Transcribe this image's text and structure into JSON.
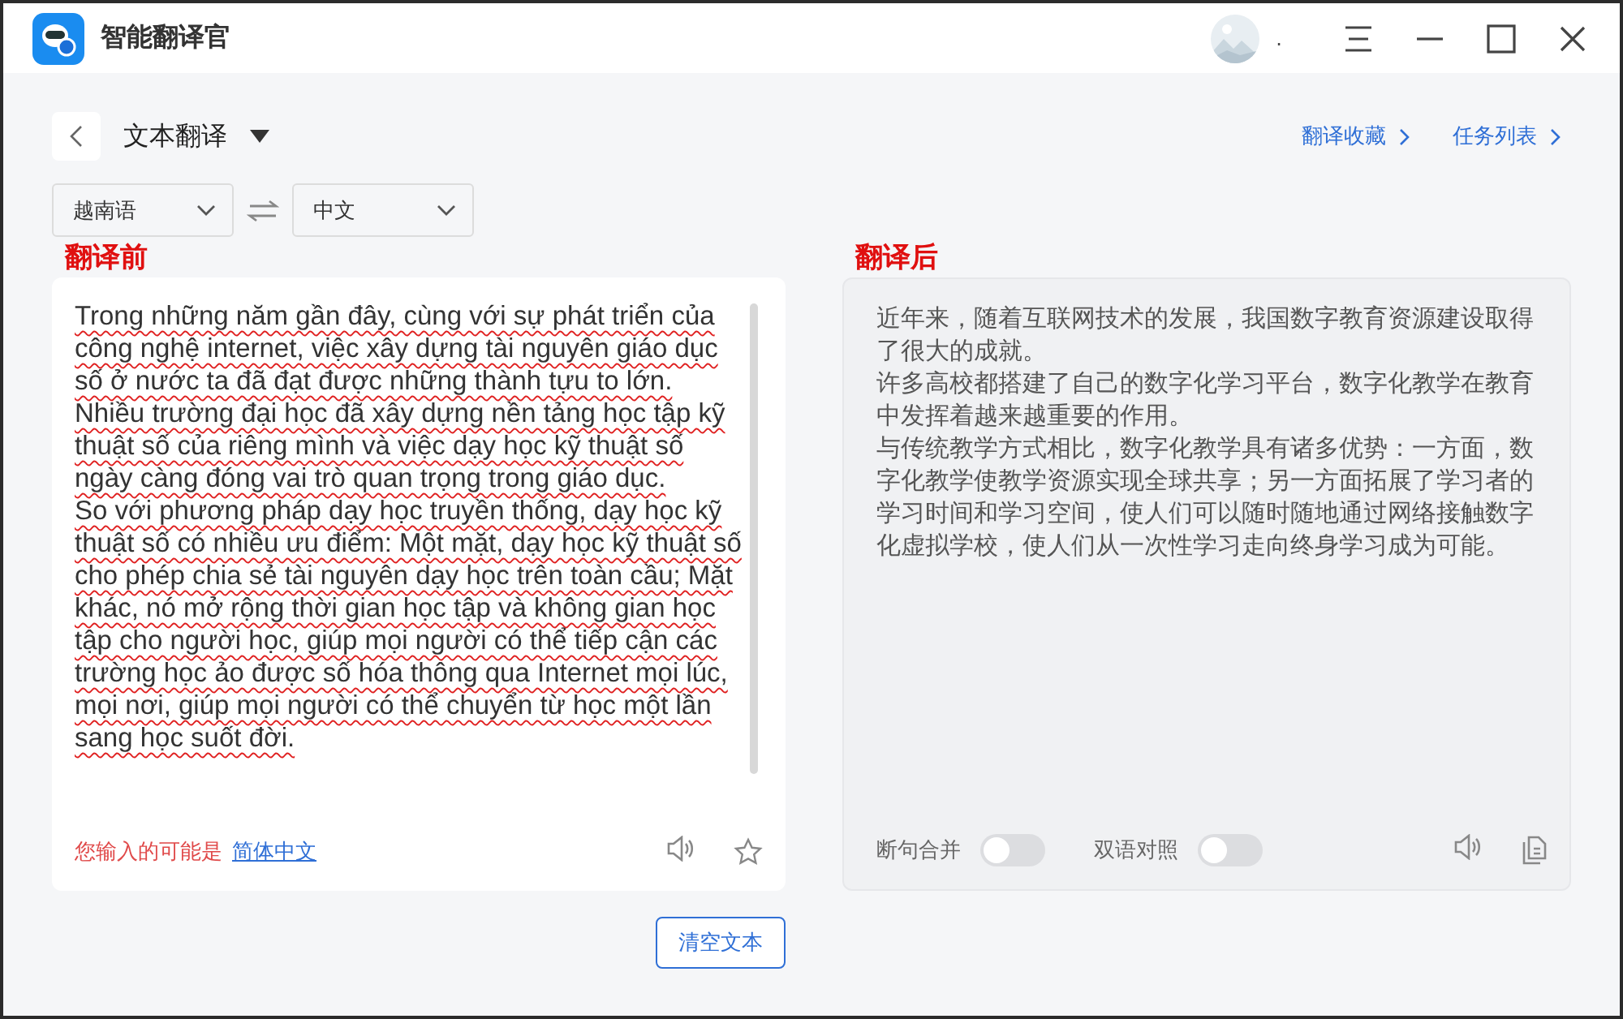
{
  "window": {
    "title": "智能翻译官",
    "user_label": "."
  },
  "header": {
    "title": "文本翻译",
    "links": [
      "翻译收藏",
      "任务列表"
    ]
  },
  "languages": {
    "source": "越南语",
    "target": "中文"
  },
  "source_panel": {
    "annotation": "翻译前",
    "paragraphs": [
      "Trong những năm gần đây, cùng với sự phát triển của công nghệ internet, việc xây dựng tài nguyên giáo dục số ở nước ta đã đạt được những thành tựu to lớn.",
      "Nhiều trường đại học đã xây dựng nền tảng học tập kỹ thuật số của riêng mình và việc dạy học kỹ thuật số ngày càng đóng vai trò quan trọng trong giáo dục.",
      "So với phương pháp dạy học truyền thống, dạy học kỹ thuật số có nhiều ưu điểm: Một mặt, dạy học kỹ thuật số cho phép chia sẻ tài nguyên dạy học trên toàn cầu; Mặt khác, nó mở rộng thời gian học tập và không gian học tập cho người học, giúp mọi người có thể tiếp cận các trường học ảo được số hóa thông qua Internet mọi lúc, mọi nơi, giúp mọi người có thể chuyển từ học một lần sang học suốt đời."
    ],
    "hint": "您输入的可能是",
    "hint_link": "简体中文"
  },
  "target_panel": {
    "annotation": "翻译后",
    "paragraphs": [
      "近年来，随着互联网技术的发展，我国数字教育资源建设取得了很大的成就。",
      "许多高校都搭建了自己的数字化学习平台，数字化教学在教育中发挥着越来越重要的作用。",
      "与传统教学方式相比，数字化教学具有诸多优势：一方面，数字化教学使教学资源实现全球共享；另一方面拓展了学习者的学习时间和学习空间，使人们可以随时随地通过网络接触数字化虚拟学校，使人们从一次性学习走向终身学习成为可能。"
    ],
    "toggles": [
      {
        "label": "断句合并",
        "on": false
      },
      {
        "label": "双语对照",
        "on": false
      }
    ]
  },
  "clear_button": "清空文本"
}
